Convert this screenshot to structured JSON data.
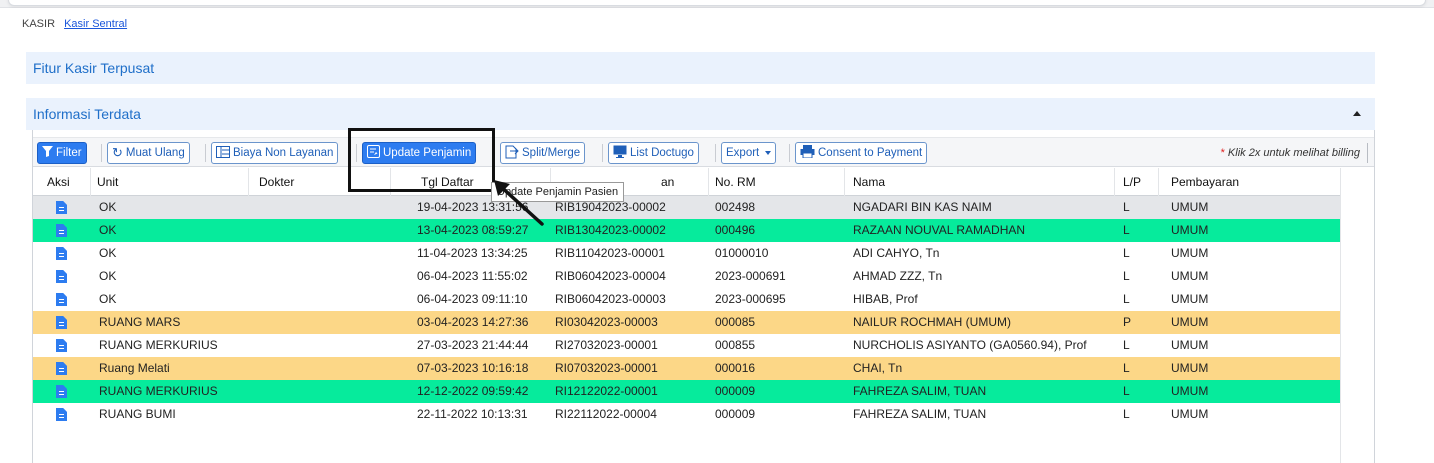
{
  "breadcrumb": {
    "root": "KASIR",
    "current": "Kasir Sentral"
  },
  "panels": {
    "fitur": "Fitur Kasir Terpusat",
    "informasi": "Informasi Terdata"
  },
  "toolbar": {
    "filter": "Filter",
    "muat_ulang": "Muat Ulang",
    "biaya_non_layanan": "Biaya Non Layanan",
    "update_penjamin": "Update Penjamin",
    "split_merge": "Split/Merge",
    "list_doctugo": "List Doctugo",
    "export": "Export",
    "consent": "Consent to Payment",
    "hint_star": "*",
    "hint": "Klik 2x untuk melihat billing"
  },
  "tooltip": "Update Penjamin Pasien",
  "columns": {
    "aksi": "Aksi",
    "unit": "Unit",
    "dokter": "Dokter",
    "tgl": "Tgl Daftar",
    "layanan": "an",
    "rm": "No. RM",
    "nama": "Nama",
    "lp": "L/P",
    "bayar": "Pembayaran"
  },
  "colors": {
    "accent": "#2d7cf0",
    "green_row": "#06eb9c",
    "yellow_row": "#fcd787",
    "grey_row": "#e4e6e9"
  },
  "rows": [
    {
      "unit": "OK",
      "tgl": "19-04-2023 13:31:56",
      "no": "RIB19042023-00002",
      "rm": "002498",
      "nama": "NGADARI BIN KAS NAIM",
      "lp": "L",
      "bayar": "UMUM",
      "tone": "grey"
    },
    {
      "unit": "OK",
      "tgl": "13-04-2023 08:59:27",
      "no": "RIB13042023-00002",
      "rm": "000496",
      "nama": "RAZAAN NOUVAL RAMADHAN",
      "lp": "L",
      "bayar": "UMUM",
      "tone": "green"
    },
    {
      "unit": "OK",
      "tgl": "11-04-2023 13:34:25",
      "no": "RIB11042023-00001",
      "rm": "01000010",
      "nama": "ADI CAHYO, Tn",
      "lp": "L",
      "bayar": "UMUM",
      "tone": "white"
    },
    {
      "unit": "OK",
      "tgl": "06-04-2023 11:55:02",
      "no": "RIB06042023-00004",
      "rm": "2023-000691",
      "nama": "AHMAD ZZZ, Tn",
      "lp": "L",
      "bayar": "UMUM",
      "tone": "white"
    },
    {
      "unit": "OK",
      "tgl": "06-04-2023 09:11:10",
      "no": "RIB06042023-00003",
      "rm": "2023-000695",
      "nama": "HIBAB, Prof",
      "lp": "L",
      "bayar": "UMUM",
      "tone": "white"
    },
    {
      "unit": "RUANG MARS",
      "tgl": "03-04-2023 14:27:36",
      "no": "RI03042023-00003",
      "rm": "000085",
      "nama": "NAILUR ROCHMAH (UMUM)",
      "lp": "P",
      "bayar": "UMUM",
      "tone": "yellow"
    },
    {
      "unit": "RUANG MERKURIUS",
      "tgl": "27-03-2023 21:44:44",
      "no": "RI27032023-00001",
      "rm": "000855",
      "nama": "NURCHOLIS ASIYANTO (GA0560.94), Prof",
      "lp": "L",
      "bayar": "UMUM",
      "tone": "white"
    },
    {
      "unit": "Ruang Melati",
      "tgl": "07-03-2023 10:16:18",
      "no": "RI07032023-00001",
      "rm": "000016",
      "nama": "CHAI, Tn",
      "lp": "L",
      "bayar": "UMUM",
      "tone": "yellow"
    },
    {
      "unit": "RUANG MERKURIUS",
      "tgl": "12-12-2022 09:59:42",
      "no": "RI12122022-00001",
      "rm": "000009",
      "nama": "FAHREZA SALIM, TUAN",
      "lp": "L",
      "bayar": "UMUM",
      "tone": "green"
    },
    {
      "unit": "RUANG BUMI",
      "tgl": "22-11-2022 10:13:31",
      "no": "RI22112022-00004",
      "rm": "000009",
      "nama": "FAHREZA SALIM, TUAN",
      "lp": "L",
      "bayar": "UMUM",
      "tone": "white"
    }
  ]
}
